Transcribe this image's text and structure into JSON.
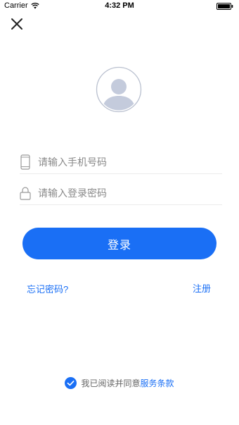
{
  "status_bar": {
    "carrier": "Carrier",
    "time": "4:32 PM",
    "icons": [
      "wifi-icon",
      "battery-icon"
    ]
  },
  "header": {
    "close_icon": "close-icon"
  },
  "avatar": {
    "icon": "user-avatar-icon"
  },
  "form": {
    "phone_placeholder": "请输入手机号码",
    "phone_value": "",
    "phone_icon": "phone-icon",
    "password_placeholder": "请输入登录密码",
    "password_value": "",
    "password_icon": "lock-icon",
    "login_label": "登录"
  },
  "links": {
    "forgot_password": "忘记密码?",
    "register": "注册"
  },
  "agreement": {
    "checked": true,
    "text": "我已阅读并同意",
    "terms_link": "服务条款"
  },
  "colors": {
    "accent": "#1a6ff5",
    "avatar_fill": "#c4cbdc",
    "avatar_ring": "#b9c0cf"
  }
}
